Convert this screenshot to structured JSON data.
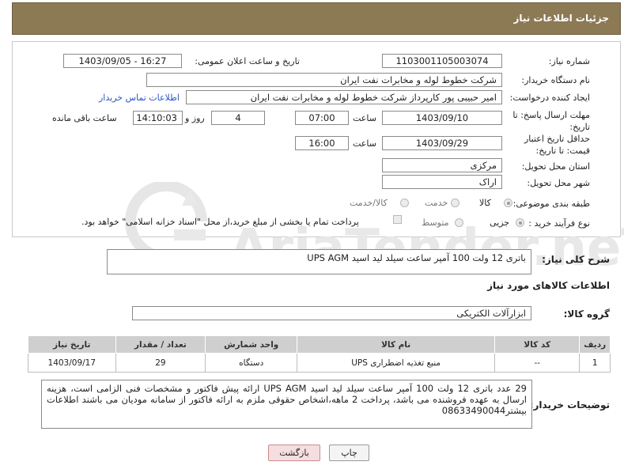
{
  "header": {
    "title": "جزئیات اطلاعات نیاز"
  },
  "need_number": {
    "label": "شماره نیاز:",
    "value": "1103001105003074"
  },
  "announce": {
    "label": "تاریخ و ساعت اعلان عمومی:",
    "value": "1403/09/05 - 16:27"
  },
  "buyer": {
    "label": "نام دستگاه خریدار:",
    "value": "شرکت خطوط لوله و مخابرات نفت ایران"
  },
  "requester": {
    "label": "ایجاد کننده درخواست:",
    "value": "امیر  حبیبی پور  کارپرداز شرکت خطوط لوله و مخابرات نفت ایران",
    "contact_link": "اطلاعات تماس خریدار"
  },
  "deadline": {
    "label": "مهلت ارسال پاسخ: تا تاریخ:",
    "date": "1403/09/10",
    "time_label": "ساعت",
    "time": "07:00",
    "days": "4",
    "days_label": "روز و",
    "remaining": "14:10:03",
    "remaining_label": "ساعت باقی مانده"
  },
  "validity": {
    "label": "حداقل تاریخ اعتبار قیمت: تا تاریخ:",
    "date": "1403/09/29",
    "time_label": "ساعت",
    "time": "16:00"
  },
  "province": {
    "label": "استان محل تحویل:",
    "value": "مرکزی"
  },
  "city": {
    "label": "شهر محل تحویل:",
    "value": "اراک"
  },
  "category": {
    "label": "طبقه بندی موضوعی:",
    "options": [
      "کالا",
      "خدمت",
      "کالا/خدمت"
    ]
  },
  "purchase": {
    "label": "نوع فرآیند خرید :",
    "options": [
      "جزیی",
      "متوسط"
    ],
    "note": "پرداخت تمام یا بخشی از مبلغ خرید،از محل \"اسناد خزانه اسلامی\" خواهد بود."
  },
  "summary": {
    "label": "شرح کلی نیاز:",
    "value": "باتری 12 ولت 100 آمپر ساعت سیلد لید اسید UPS AGM"
  },
  "goods_info": {
    "title": "اطلاعات کالاهای مورد نیاز"
  },
  "goods_group": {
    "label": "گروه کالا:",
    "value": "ابزارآلات الکتریکی"
  },
  "table": {
    "headers": [
      "ردیف",
      "کد کالا",
      "نام کالا",
      "واحد شمارش",
      "تعداد / مقدار",
      "تاریخ نیاز"
    ],
    "rows": [
      [
        "1",
        "--",
        "منبع تغذیه اضطراری UPS",
        "دستگاه",
        "29",
        "1403/09/17"
      ]
    ]
  },
  "buyer_notes": {
    "label": "توضیحات خریدار:",
    "value": "29 عدد باتری 12 ولت 100 آمپر ساعت سیلد لید اسید UPS AGM ارائه پیش فاکتور و مشخصات فنی الزامی است، هزینه ارسال به عهده فروشنده می باشد، پرداخت 2 ماهه،اشخاص حقوقی ملزم به ارائه فاکتور از سامانه مودیان می باشند اطلاعات بیشتر08633490044"
  },
  "buttons": {
    "print": "چاپ",
    "back": "بازگشت"
  },
  "watermark": {
    "text": "AriaTender.neT"
  },
  "colors": {
    "header_bg": "#8c7a55",
    "link": "#2a56c6",
    "back_button_bg": "#f6dede"
  }
}
